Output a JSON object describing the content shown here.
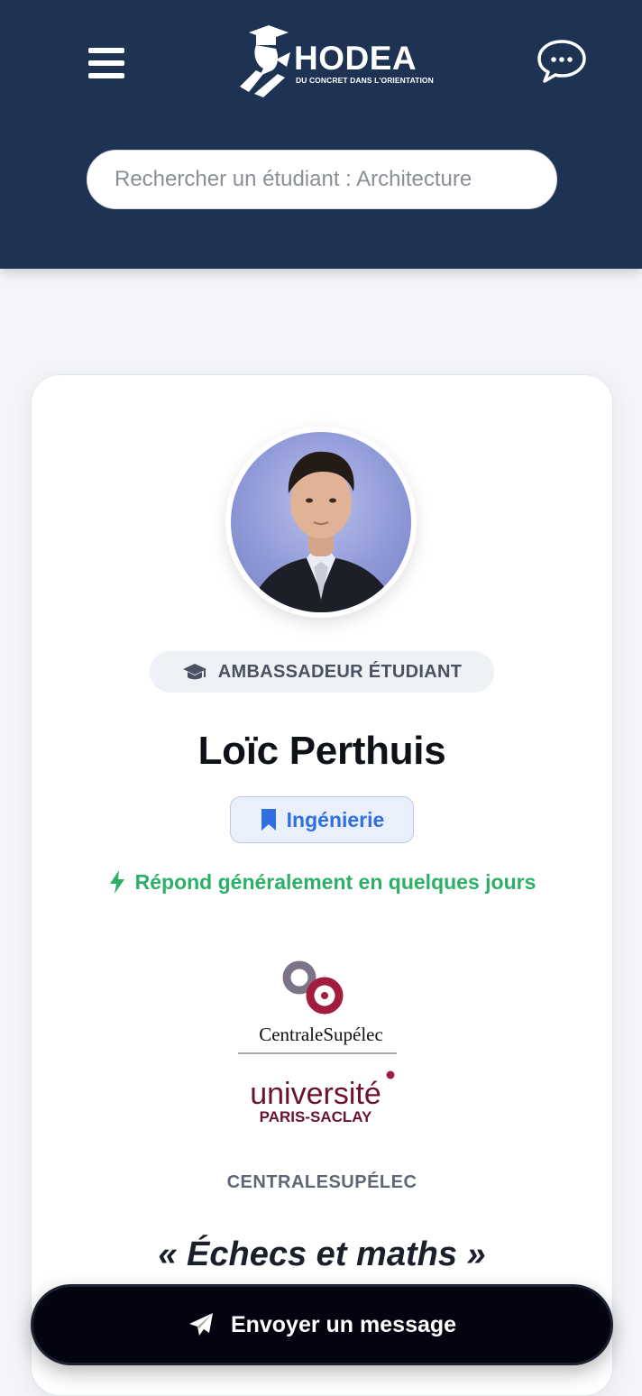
{
  "header": {
    "logo_text": "HODEA",
    "logo_tagline": "DU CONCRET DANS L'ORIENTATION",
    "search_placeholder": "Rechercher un étudiant : Architecture"
  },
  "profile": {
    "role_badge": "AMBASSADEUR ÉTUDIANT",
    "name": "Loïc Perthuis",
    "field_tag": "Ingénierie",
    "response_time": "Répond généralement en quelques jours",
    "school_logo_lines": [
      "CentraleSupélec",
      "université",
      "PARIS-SACLAY"
    ],
    "school_name": "CENTRALESUPÉLEC",
    "quote": "Échecs et maths",
    "quote_open": "«",
    "quote_close": "»"
  },
  "actions": {
    "send_message": "Envoyer un message"
  },
  "colors": {
    "header_bg": "#1e3354",
    "accent_blue": "#2f6fe0",
    "response_green": "#2cb067",
    "school_red": "#a31c3e"
  },
  "icons": {
    "menu": "hamburger-icon",
    "chat": "chat-bubble-icon",
    "badge": "graduation-cap-icon",
    "tag": "bookmark-icon",
    "response": "lightning-icon",
    "send": "paper-plane-icon"
  }
}
